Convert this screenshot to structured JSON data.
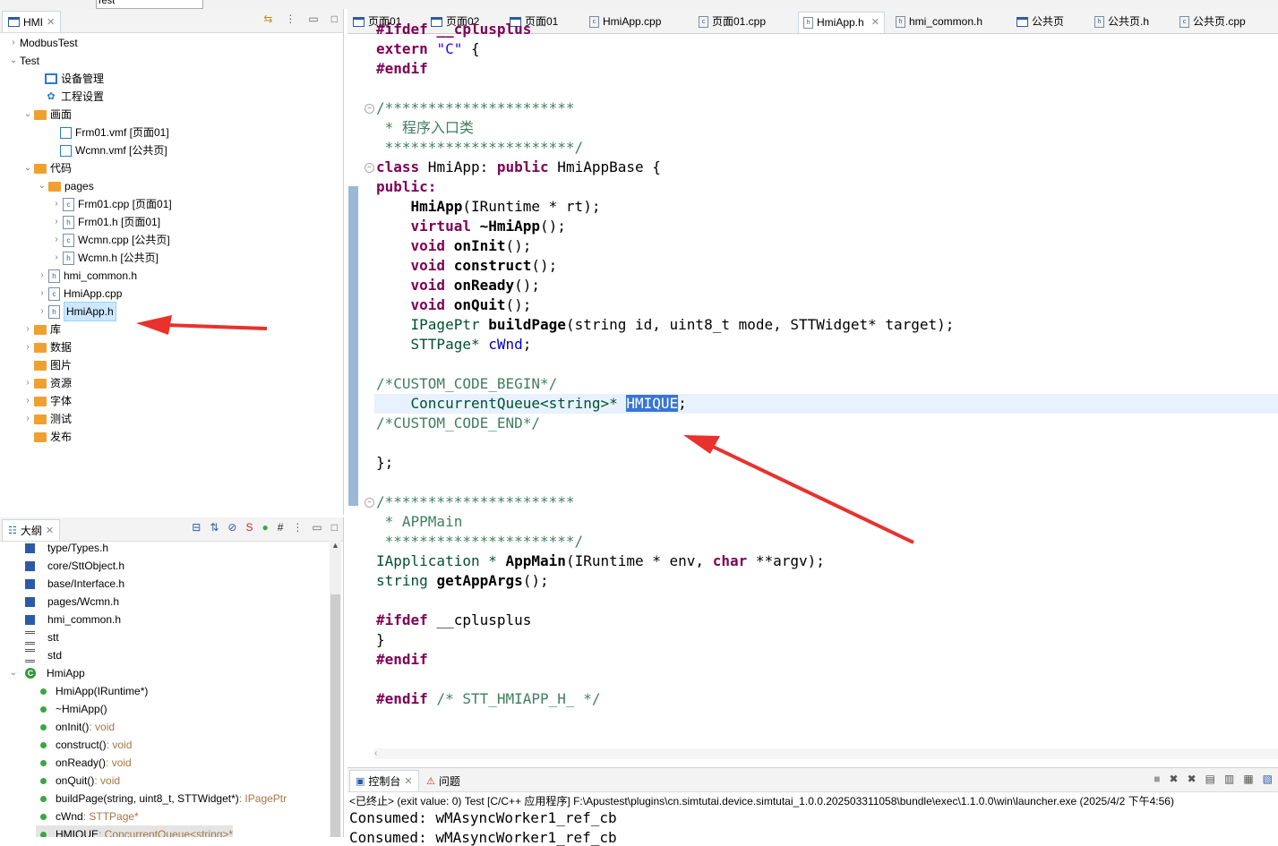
{
  "toolbar": {
    "search_value": "Test"
  },
  "project_view": {
    "tab_label": "HMI",
    "items": [
      {
        "label": "ModbusTest"
      },
      {
        "label": "Test"
      },
      {
        "label": "设备管理"
      },
      {
        "label": "工程设置"
      },
      {
        "label": "画面"
      },
      {
        "label": "Frm01.vmf [页面01]"
      },
      {
        "label": "Wcmn.vmf [公共页]"
      },
      {
        "label": "代码"
      },
      {
        "label": "pages"
      },
      {
        "label": "Frm01.cpp [页面01]"
      },
      {
        "label": "Frm01.h [页面01]"
      },
      {
        "label": "Wcmn.cpp [公共页]"
      },
      {
        "label": "Wcmn.h [公共页]"
      },
      {
        "label": "hmi_common.h"
      },
      {
        "label": "HmiApp.cpp"
      },
      {
        "label": "HmiApp.h"
      },
      {
        "label": "库"
      },
      {
        "label": "数据"
      },
      {
        "label": "图片"
      },
      {
        "label": "资源"
      },
      {
        "label": "字体"
      },
      {
        "label": "测试"
      },
      {
        "label": "发布"
      }
    ]
  },
  "outline_view": {
    "tab_label": "大纲",
    "items": [
      {
        "label": "type/Types.h",
        "type": ""
      },
      {
        "label": "core/SttObject.h",
        "type": ""
      },
      {
        "label": "base/Interface.h",
        "type": ""
      },
      {
        "label": "pages/Wcmn.h",
        "type": ""
      },
      {
        "label": "hmi_common.h",
        "type": ""
      },
      {
        "label": "stt",
        "type": ""
      },
      {
        "label": "std",
        "type": ""
      },
      {
        "label": "HmiApp",
        "type": ""
      },
      {
        "label": "HmiApp(IRuntime*)",
        "type": ""
      },
      {
        "label": "~HmiApp()",
        "type": ""
      },
      {
        "label": "onInit()",
        "type": " : void"
      },
      {
        "label": "construct()",
        "type": " : void"
      },
      {
        "label": "onReady()",
        "type": " : void"
      },
      {
        "label": "onQuit()",
        "type": " : void"
      },
      {
        "label": "buildPage(string, uint8_t, STTWidget*)",
        "type": " : IPagePtr"
      },
      {
        "label": "cWnd",
        "type": " : STTPage*"
      },
      {
        "label": "HMIQUE",
        "type": " : ConcurrentQueue<string>*"
      }
    ]
  },
  "editor_tabs": [
    {
      "label": "页面01"
    },
    {
      "label": "页面02"
    },
    {
      "label": "页面01"
    },
    {
      "label": "HmiApp.cpp"
    },
    {
      "label": "页面01.cpp"
    },
    {
      "label": "HmiApp.h"
    },
    {
      "label": "hmi_common.h"
    },
    {
      "label": "公共页"
    },
    {
      "label": "公共页.h"
    },
    {
      "label": "公共页.cpp"
    }
  ],
  "code": {
    "l0": "#ifdef __cplusplus",
    "l1a": "extern ",
    "l1b": "\"C\"",
    "l1c": " {",
    "l2": "#endif",
    "l4": "/**********************",
    "l5": " * 程序入口类",
    "l6": " **********************/",
    "l7a": "class",
    "l7b": " HmiApp: ",
    "l7c": "public",
    "l7d": " HmiAppBase {",
    "l8": "public:",
    "l9a": "    ",
    "l9b": "HmiApp",
    "l9c": "(IRuntime * rt);",
    "l10a": "    virtual",
    "l10b": " ~HmiApp",
    "l10c": "();",
    "l11a": "    void",
    "l11b": " onInit",
    "l11c": "();",
    "l12a": "    void",
    "l12b": " construct",
    "l12c": "();",
    "l13a": "    void",
    "l13b": " onReady",
    "l13c": "();",
    "l14a": "    void",
    "l14b": " onQuit",
    "l14c": "();",
    "l15a": "    IPagePtr ",
    "l15b": "buildPage",
    "l15c": "(string id, uint8_t mode, STTWidget* target);",
    "l16a": "    STTPage* ",
    "l16b": "cWnd",
    "l16c": ";",
    "l18": "/*CUSTOM_CODE_BEGIN*/",
    "l19a": "    ConcurrentQueue<string>* ",
    "l19b": "HMIQUE",
    "l19c": ";",
    "l20": "/*CUSTOM_CODE_END*/",
    "l22": "};",
    "l24": "/**********************",
    "l25": " * APPMain",
    "l26": " **********************/",
    "l27a": "IApplication * ",
    "l27b": "AppMain",
    "l27c": "(IRuntime * env, ",
    "l27d": "char",
    "l27e": " **argv);",
    "l28a": "string ",
    "l28b": "getAppArgs",
    "l28c": "();",
    "l30a": "#ifdef",
    "l30b": " __cplusplus",
    "l31": "}",
    "l32": "#endif",
    "l34a": "#endif",
    "l34b": " /* STT_HMIAPP_H_ */"
  },
  "console": {
    "tab_console": "控制台",
    "tab_problems": "问题",
    "status_line": "<已终止> (exit value: 0) Test [C/C++ 应用程序] F:\\Apustest\\plugins\\cn.simtutai.device.simtutai_1.0.0.202503311058\\bundle\\exec\\1.1.0.0\\win\\launcher.exe (2025/4/2 下午4:56)",
    "output": [
      "Consumed: wMAsyncWorker1_ref_cb",
      "Consumed: wMAsyncWorker1_ref_cb"
    ]
  },
  "colors": {
    "annotation_arrow": "#e8322e",
    "selection": "#3875d7"
  }
}
